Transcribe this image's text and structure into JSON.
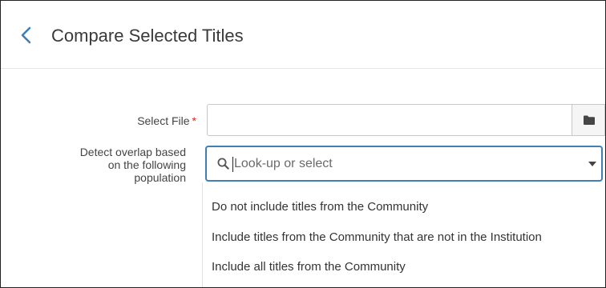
{
  "header": {
    "title": "Compare Selected Titles"
  },
  "form": {
    "select_file_label": "Select File",
    "required_marker": "*",
    "overlap_label_lines": [
      "Detect overlap based",
      "on the following",
      "population"
    ],
    "lookup_placeholder": "Look-up or select"
  },
  "dropdown": {
    "options": [
      "Do not include titles from the Community",
      "Include titles from the Community that are not in the Institution",
      "Include all titles from the Community"
    ]
  },
  "colors": {
    "accent": "#3f7fb5",
    "required": "#d62728"
  }
}
